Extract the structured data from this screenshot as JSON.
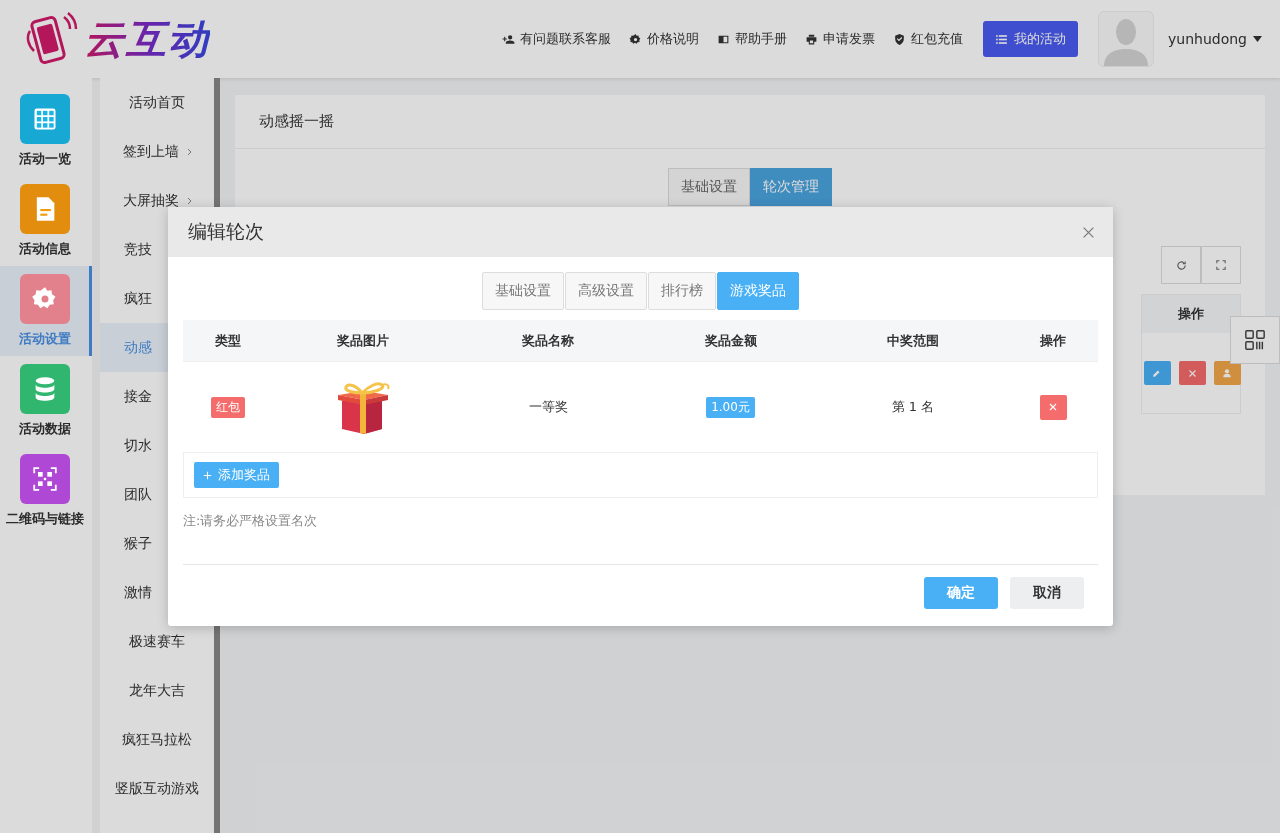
{
  "header": {
    "logo": "云互动",
    "links": [
      {
        "label": "有问题联系客服"
      },
      {
        "label": "价格说明"
      },
      {
        "label": "帮助手册"
      },
      {
        "label": "申请发票"
      },
      {
        "label": "红包充值"
      }
    ],
    "primary_button": "我的活动",
    "username": "yunhudong"
  },
  "icon_nav": [
    {
      "label": "活动一览",
      "color": "#17a8d4",
      "selected": false
    },
    {
      "label": "活动信息",
      "color": "#e38d0e",
      "selected": false
    },
    {
      "label": "活动设置",
      "color": "#e2818c",
      "selected": true
    },
    {
      "label": "活动数据",
      "color": "#31b670",
      "selected": false
    },
    {
      "label": "二维码与链接",
      "color": "#b048d6",
      "selected": false
    }
  ],
  "submenu": [
    {
      "label": "活动首页",
      "selected": false,
      "expandable": false
    },
    {
      "label": "签到上墙",
      "selected": false,
      "expandable": true
    },
    {
      "label": "大屏抽奖",
      "selected": false,
      "expandable": true
    },
    {
      "label": "竞技",
      "selected": false,
      "expandable": false
    },
    {
      "label": "疯狂",
      "selected": false,
      "expandable": false
    },
    {
      "label": "动感",
      "selected": true,
      "expandable": false
    },
    {
      "label": "接金",
      "selected": false,
      "expandable": false
    },
    {
      "label": "切水",
      "selected": false,
      "expandable": false
    },
    {
      "label": "团队",
      "selected": false,
      "expandable": false
    },
    {
      "label": "猴子",
      "selected": false,
      "expandable": false
    },
    {
      "label": "激情",
      "selected": false,
      "expandable": false
    },
    {
      "label": "极速赛车",
      "selected": false,
      "expandable": false
    },
    {
      "label": "龙年大吉",
      "selected": false,
      "expandable": false
    },
    {
      "label": "疯狂马拉松",
      "selected": false,
      "expandable": false
    },
    {
      "label": "竖版互动游戏",
      "selected": false,
      "expandable": false
    }
  ],
  "page": {
    "title": "动感摇一摇",
    "tabs": [
      {
        "label": "基础设置",
        "selected": false
      },
      {
        "label": "轮次管理",
        "selected": true
      }
    ],
    "table_header": "操作"
  },
  "modal": {
    "title": "编辑轮次",
    "tabs": [
      {
        "label": "基础设置",
        "selected": false
      },
      {
        "label": "高级设置",
        "selected": false
      },
      {
        "label": "排行榜",
        "selected": false
      },
      {
        "label": "游戏奖品",
        "selected": true
      }
    ],
    "columns": [
      "类型",
      "奖品图片",
      "奖品名称",
      "奖品金额",
      "中奖范围",
      "操作"
    ],
    "rows": [
      {
        "type": "红包",
        "name": "一等奖",
        "amount": "1.00元",
        "range": "第 1 名"
      }
    ],
    "add_button": "添加奖品",
    "note": "注:请务必严格设置名次",
    "confirm": "确定",
    "cancel": "取消"
  }
}
